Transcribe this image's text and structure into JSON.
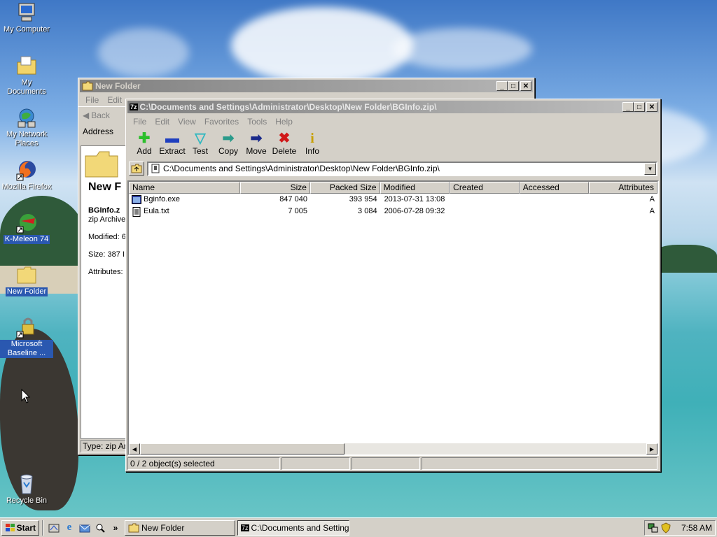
{
  "desktop": {
    "icons": [
      {
        "label": "My Computer",
        "icon": "computer-icon"
      },
      {
        "label": "My Documents",
        "icon": "documents-folder-icon"
      },
      {
        "label": "My Network Places",
        "icon": "network-icon"
      },
      {
        "label": "Mozilla Firefox",
        "icon": "firefox-icon"
      },
      {
        "label": "K-Meleon 74",
        "icon": "k-meleon-icon"
      },
      {
        "label": "New Folder",
        "icon": "folder-icon"
      },
      {
        "label": "Microsoft Baseline ...",
        "icon": "mbsa-icon"
      },
      {
        "label": "Recycle Bin",
        "icon": "recycle-bin-icon"
      }
    ]
  },
  "explorer": {
    "title": "New Folder",
    "menu": [
      "File",
      "Edit"
    ],
    "back_label": "Back",
    "address_label": "Address",
    "heading": "New F",
    "file_name": "BGInfo.z",
    "file_type": "zip Archive",
    "modified": "Modified: 6",
    "size": "Size: 387 I",
    "attributes": "Attributes:",
    "status_type": "Type: zip Arc"
  },
  "sevenzip": {
    "app_badge": "7z",
    "title": "C:\\Documents and Settings\\Administrator\\Desktop\\New Folder\\BGInfo.zip\\",
    "menu": [
      "File",
      "Edit",
      "View",
      "Favorites",
      "Tools",
      "Help"
    ],
    "toolbar": [
      {
        "label": "Add",
        "icon": "add-icon",
        "glyph": "✚",
        "color": "#2cbf2c"
      },
      {
        "label": "Extract",
        "icon": "extract-icon",
        "glyph": "▬",
        "color": "#1f3fbf"
      },
      {
        "label": "Test",
        "icon": "test-icon",
        "glyph": "▽",
        "color": "#30b8c0"
      },
      {
        "label": "Copy",
        "icon": "copy-icon",
        "glyph": "➡",
        "color": "#2a9a8a"
      },
      {
        "label": "Move",
        "icon": "move-icon",
        "glyph": "➡",
        "color": "#1a2a8a"
      },
      {
        "label": "Delete",
        "icon": "delete-icon",
        "glyph": "✖",
        "color": "#d01818"
      },
      {
        "label": "Info",
        "icon": "info-icon",
        "glyph": "i",
        "color": "#c8a000"
      }
    ],
    "path": "C:\\Documents and Settings\\Administrator\\Desktop\\New Folder\\BGInfo.zip\\",
    "columns": [
      "Name",
      "Size",
      "Packed Size",
      "Modified",
      "Created",
      "Accessed",
      "Attributes"
    ],
    "rows": [
      {
        "name": "Bginfo.exe",
        "size": "847 040",
        "packed": "393 954",
        "modified": "2013-07-31 13:08",
        "created": "",
        "accessed": "",
        "attributes": "A",
        "icon": "exe-icon"
      },
      {
        "name": "Eula.txt",
        "size": "7 005",
        "packed": "3 084",
        "modified": "2006-07-28 09:32",
        "created": "",
        "accessed": "",
        "attributes": "A",
        "icon": "text-file-icon"
      }
    ],
    "status": "0 / 2 object(s) selected"
  },
  "taskbar": {
    "start_label": "Start",
    "tasks": [
      {
        "label": "New Folder",
        "icon": "folder-icon"
      },
      {
        "label": "C:\\Documents and Setting...",
        "icon": "7zip-icon"
      }
    ],
    "clock": "7:58 AM"
  }
}
